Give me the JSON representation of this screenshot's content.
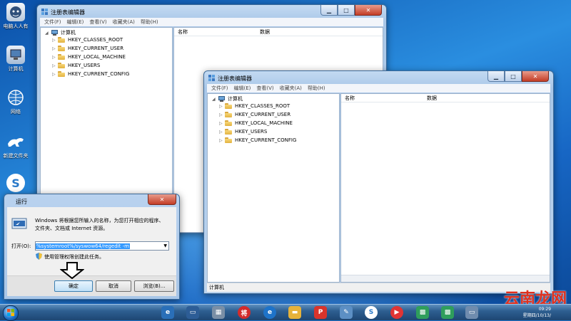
{
  "desktop": {
    "icons": [
      {
        "label": "电脑人人有",
        "icon": "tiger-icon"
      },
      {
        "label": "计算机",
        "icon": "computer-icon"
      },
      {
        "label": "网络",
        "icon": "network-icon"
      },
      {
        "label": "新建文件夹",
        "icon": "folder-icon"
      },
      {
        "label": "",
        "icon": "sogou-icon"
      }
    ]
  },
  "regedit_back": {
    "title": "注册表编辑器",
    "menu": [
      "文件(F)",
      "编辑(E)",
      "查看(V)",
      "收藏夹(A)",
      "帮助(H)"
    ],
    "root": "计算机",
    "keys": [
      "HKEY_CLASSES_ROOT",
      "HKEY_CURRENT_USER",
      "HKEY_LOCAL_MACHINE",
      "HKEY_USERS",
      "HKEY_CURRENT_CONFIG"
    ],
    "col_name": "名称",
    "col_data": "数据"
  },
  "regedit_front": {
    "title": "注册表编辑器",
    "menu": [
      "文件(F)",
      "编辑(E)",
      "查看(V)",
      "收藏夹(A)",
      "帮助(H)"
    ],
    "root": "计算机",
    "keys": [
      "HKEY_CLASSES_ROOT",
      "HKEY_CURRENT_USER",
      "HKEY_LOCAL_MACHINE",
      "HKEY_USERS",
      "HKEY_CURRENT_CONFIG"
    ],
    "col_name": "名称",
    "col_data": "数据",
    "status": "计算机"
  },
  "run_dialog": {
    "title": "运行",
    "description_line1": "Windows 将根据您所输入的名称，为您打开相应的程序、",
    "description_line2": "文件夹、文档或 Internet 资源。",
    "open_label": "打开(O):",
    "open_value": "%systemroot%/syswow64/regedit -m",
    "admin_note": "使用管理权限创建此任务。",
    "ok": "确定",
    "cancel": "取消",
    "browse": "浏览(B)..."
  },
  "watermark": "云南龙网",
  "clock": {
    "time": "09:29",
    "date": "星期四/10/13/"
  }
}
